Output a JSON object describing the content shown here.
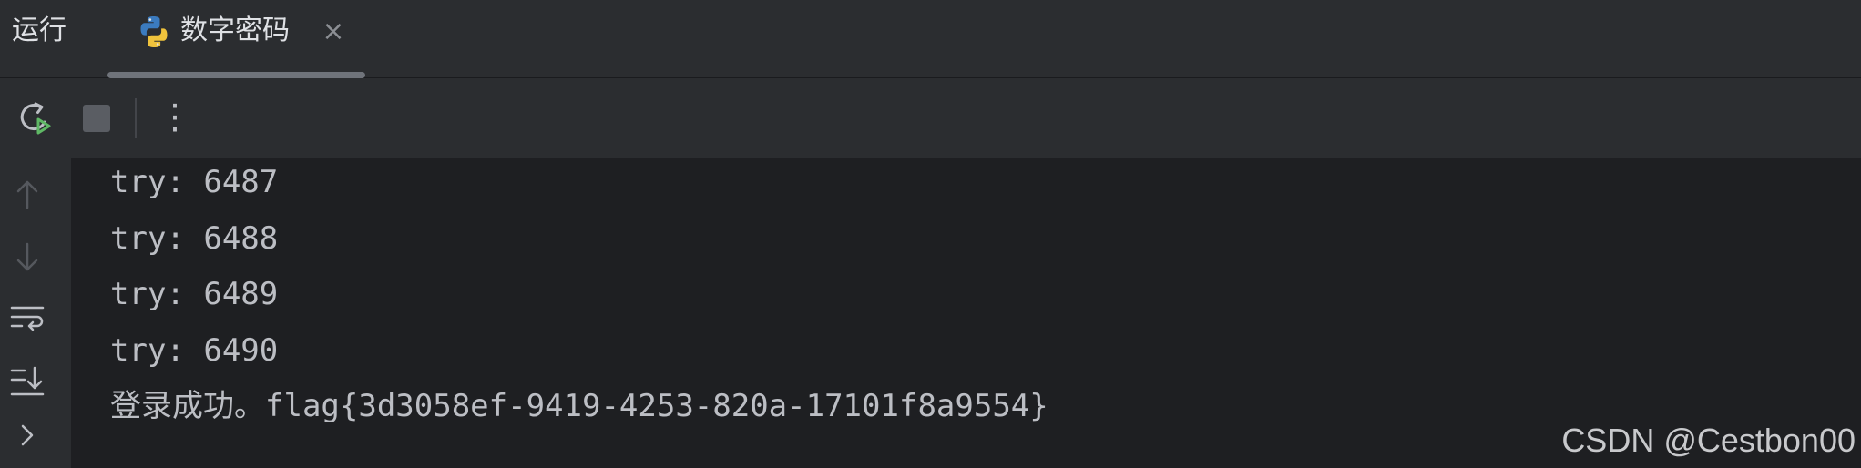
{
  "panel": {
    "title": "运行"
  },
  "tab": {
    "label": "数字密码",
    "icon": "python-icon",
    "close_glyph": "×"
  },
  "toolbar": {
    "rerun_icon": "rerun-icon",
    "stop_icon": "stop-icon",
    "more_glyph": "⋮"
  },
  "gutter": {
    "icons": [
      "arrow-up-icon",
      "arrow-down-icon",
      "soft-wrap-icon",
      "scroll-to-end-icon",
      "chevron-right-icon"
    ]
  },
  "console": {
    "lines": [
      "try: 6487",
      "try: 6488",
      "try: 6489",
      "try: 6490",
      "登录成功。flag{3d3058ef-9419-4253-820a-17101f8a9554}"
    ]
  },
  "watermark": "CSDN @Cestbon00",
  "colors": {
    "background": "#1e1f22",
    "panel": "#2b2d30",
    "text": "#bcbec4",
    "run_green": "#5fb865",
    "icon_gray": "#8c8f94"
  }
}
